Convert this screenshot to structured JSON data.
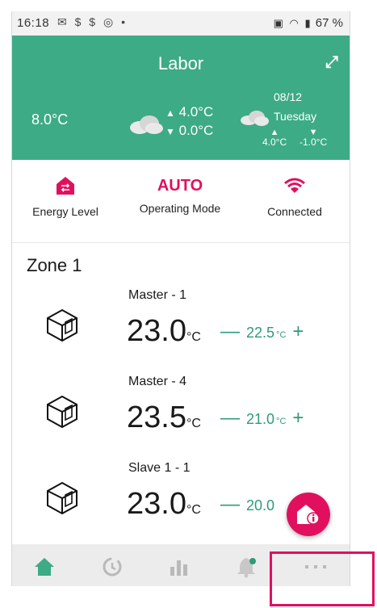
{
  "status_bar": {
    "time": "16:18",
    "battery": "67 %"
  },
  "header": {
    "title": "Labor",
    "current_temp": "8.0°C",
    "range_high": "4.0°C",
    "range_low": "0.0°C",
    "forecast_date": "08/12",
    "forecast_day": "Tuesday",
    "forecast_high": "4.0°C",
    "forecast_low": "-1.0°C"
  },
  "modes": {
    "energy_label": "Energy Level",
    "operating_value": "AUTO",
    "operating_label": "Operating Mode",
    "connection_label": "Connected"
  },
  "zone": {
    "title": "Zone 1",
    "devices": [
      {
        "name": "Master - 1",
        "temp": "23.0",
        "unit": "°C",
        "setpoint": "22.5",
        "setpoint_unit": "°C"
      },
      {
        "name": "Master - 4",
        "temp": "23.5",
        "unit": "°C",
        "setpoint": "21.0",
        "setpoint_unit": "°C"
      },
      {
        "name": "Slave 1 - 1",
        "temp": "23.0",
        "unit": "°C",
        "setpoint": "20.0",
        "setpoint_unit": ""
      }
    ]
  },
  "controls": {
    "minus": "—",
    "plus": "+"
  },
  "colors": {
    "primary": "#3dab85",
    "accent": "#e0105f",
    "nav_inactive": "#b9b9b9"
  },
  "nav": [
    "home-icon",
    "history-icon",
    "statistics-icon",
    "notifications-icon",
    "more-icon"
  ]
}
